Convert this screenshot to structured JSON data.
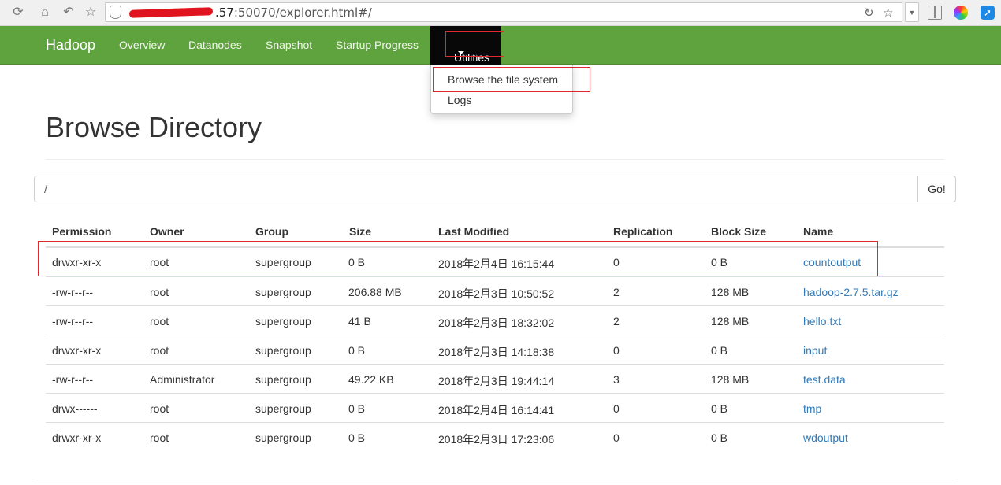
{
  "browser": {
    "url_prefix": "",
    "url_host_visible": ".57",
    "url_rest": ":50070/explorer.html#/"
  },
  "navbar": {
    "brand": "Hadoop",
    "items": [
      {
        "label": "Overview"
      },
      {
        "label": "Datanodes"
      },
      {
        "label": "Snapshot"
      },
      {
        "label": "Startup Progress"
      },
      {
        "label": "Utilities"
      }
    ]
  },
  "dropdown": {
    "items": [
      {
        "label": "Browse the file system"
      },
      {
        "label": "Logs"
      }
    ]
  },
  "page": {
    "title": "Browse Directory",
    "path_value": "/",
    "go_label": "Go!"
  },
  "table": {
    "columns": [
      "Permission",
      "Owner",
      "Group",
      "Size",
      "Last Modified",
      "Replication",
      "Block Size",
      "Name"
    ],
    "rows": [
      {
        "permission": "drwxr-xr-x",
        "owner": "root",
        "group": "supergroup",
        "size": "0 B",
        "modified": "2018年2月4日 16:15:44",
        "replication": "0",
        "block_size": "0 B",
        "name": "countoutput"
      },
      {
        "permission": "-rw-r--r--",
        "owner": "root",
        "group": "supergroup",
        "size": "206.88 MB",
        "modified": "2018年2月3日 10:50:52",
        "replication": "2",
        "block_size": "128 MB",
        "name": "hadoop-2.7.5.tar.gz"
      },
      {
        "permission": "-rw-r--r--",
        "owner": "root",
        "group": "supergroup",
        "size": "41 B",
        "modified": "2018年2月3日 18:32:02",
        "replication": "2",
        "block_size": "128 MB",
        "name": "hello.txt"
      },
      {
        "permission": "drwxr-xr-x",
        "owner": "root",
        "group": "supergroup",
        "size": "0 B",
        "modified": "2018年2月3日 14:18:38",
        "replication": "0",
        "block_size": "0 B",
        "name": "input"
      },
      {
        "permission": "-rw-r--r--",
        "owner": "Administrator",
        "group": "supergroup",
        "size": "49.22 KB",
        "modified": "2018年2月3日 19:44:14",
        "replication": "3",
        "block_size": "128 MB",
        "name": "test.data"
      },
      {
        "permission": "drwx------",
        "owner": "root",
        "group": "supergroup",
        "size": "0 B",
        "modified": "2018年2月4日 16:14:41",
        "replication": "0",
        "block_size": "0 B",
        "name": "tmp"
      },
      {
        "permission": "drwxr-xr-x",
        "owner": "root",
        "group": "supergroup",
        "size": "0 B",
        "modified": "2018年2月3日 17:23:06",
        "replication": "0",
        "block_size": "0 B",
        "name": "wdoutput"
      }
    ]
  },
  "colors": {
    "navbar": "#5fa33e",
    "active_nav": "#080808",
    "link": "#337ab7",
    "highlight": "#e0282e"
  },
  "icons": [
    "reload-icon",
    "home-icon",
    "back-icon",
    "star-icon",
    "shield-icon",
    "compat-icon",
    "bookmark-star-icon",
    "dropdown-icon",
    "apps-icon",
    "photos-icon",
    "extension-icon"
  ]
}
